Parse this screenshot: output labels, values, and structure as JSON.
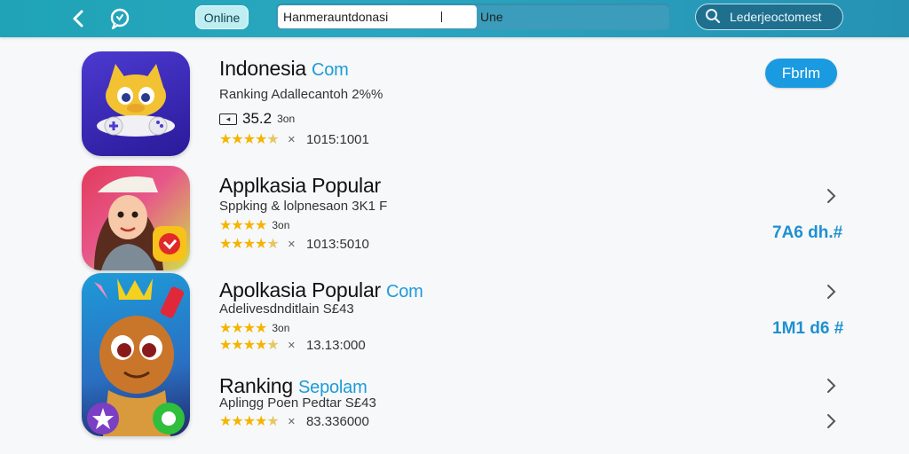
{
  "topbar": {
    "back_icon": "arrow-left-icon",
    "chat_icon": "chat-bubble-icon",
    "online_label": "Online",
    "url_value": "Hanmerauntdonasi",
    "url_tag": "Une",
    "search_label": "Lederjeoctomest",
    "search_icon": "magnifier-icon"
  },
  "apps": [
    {
      "title": "Indonesia",
      "title_accent": "Com",
      "subtitle": "Ranking Adallecantoh 2%%",
      "rank_value": "35.2",
      "rank_unit": "3on",
      "stars": "★★★★",
      "rating_text": "1015:1001",
      "action_label": "Fbrlm"
    },
    {
      "title": "Applkasia Popular",
      "title_accent": "",
      "subtitle": "Sppking & lolpnesaon 3K1 F",
      "rank_stars": "★★★★",
      "rank_unit": "3on",
      "stars": "★★★★",
      "rating_text": "1013:5010",
      "price": "7A6 dh.#"
    },
    {
      "title": "Apolkasia Popular",
      "title_accent": "Com",
      "subtitle": "Adelivesdnditlain S£43",
      "rank_stars": "★★★★",
      "rank_unit": "3on",
      "stars": "★★★★",
      "rating_text": "13.13:000",
      "price": "1M1 d6 #"
    },
    {
      "title": "Ranking",
      "title_accent": "Sepolam",
      "subtitle": "Aplingg Poen Pedtar S£43",
      "stars": "★★★★",
      "rating_text": "83.336000"
    }
  ],
  "colors": {
    "topbar": "#2aa7c0",
    "accent": "#1e9bd7",
    "star": "#f5b400",
    "button": "#1a9ae0"
  }
}
